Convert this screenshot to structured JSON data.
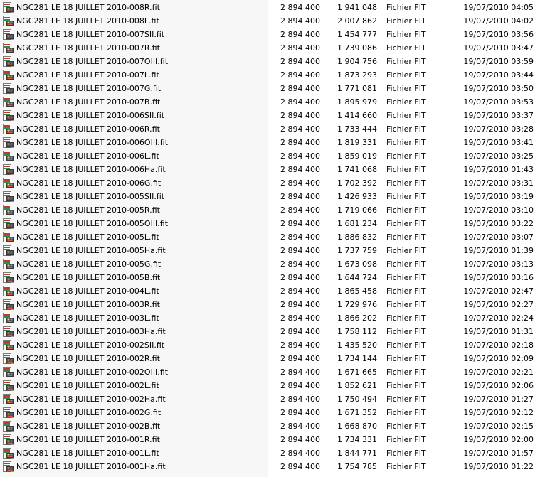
{
  "files": [
    {
      "name": "NGC281 LE 18 JUILLET 2010-008R.fit",
      "size": "2 894 400",
      "packed": "1 941 048",
      "type": "Fichier FIT",
      "date": "19/07/2010 04:05"
    },
    {
      "name": "NGC281 LE 18 JUILLET 2010-008L.fit",
      "size": "2 894 400",
      "packed": "2 007 862",
      "type": "Fichier FIT",
      "date": "19/07/2010 04:02"
    },
    {
      "name": "NGC281 LE 18 JUILLET 2010-007SII.fit",
      "size": "2 894 400",
      "packed": "1 454 777",
      "type": "Fichier FIT",
      "date": "19/07/2010 03:56"
    },
    {
      "name": "NGC281 LE 18 JUILLET 2010-007R.fit",
      "size": "2 894 400",
      "packed": "1 739 086",
      "type": "Fichier FIT",
      "date": "19/07/2010 03:47"
    },
    {
      "name": "NGC281 LE 18 JUILLET 2010-007OIII.fit",
      "size": "2 894 400",
      "packed": "1 904 756",
      "type": "Fichier FIT",
      "date": "19/07/2010 03:59"
    },
    {
      "name": "NGC281 LE 18 JUILLET 2010-007L.fit",
      "size": "2 894 400",
      "packed": "1 873 293",
      "type": "Fichier FIT",
      "date": "19/07/2010 03:44"
    },
    {
      "name": "NGC281 LE 18 JUILLET 2010-007G.fit",
      "size": "2 894 400",
      "packed": "1 771 081",
      "type": "Fichier FIT",
      "date": "19/07/2010 03:50"
    },
    {
      "name": "NGC281 LE 18 JUILLET 2010-007B.fit",
      "size": "2 894 400",
      "packed": "1 895 979",
      "type": "Fichier FIT",
      "date": "19/07/2010 03:53"
    },
    {
      "name": "NGC281 LE 18 JUILLET 2010-006SII.fit",
      "size": "2 894 400",
      "packed": "1 414 660",
      "type": "Fichier FIT",
      "date": "19/07/2010 03:37"
    },
    {
      "name": "NGC281 LE 18 JUILLET 2010-006R.fit",
      "size": "2 894 400",
      "packed": "1 733 444",
      "type": "Fichier FIT",
      "date": "19/07/2010 03:28"
    },
    {
      "name": "NGC281 LE 18 JUILLET 2010-006OIII.fit",
      "size": "2 894 400",
      "packed": "1 819 331",
      "type": "Fichier FIT",
      "date": "19/07/2010 03:41"
    },
    {
      "name": "NGC281 LE 18 JUILLET 2010-006L.fit",
      "size": "2 894 400",
      "packed": "1 859 019",
      "type": "Fichier FIT",
      "date": "19/07/2010 03:25"
    },
    {
      "name": "NGC281 LE 18 JUILLET 2010-006Ha.fit",
      "size": "2 894 400",
      "packed": "1 741 068",
      "type": "Fichier FIT",
      "date": "19/07/2010 01:43"
    },
    {
      "name": "NGC281 LE 18 JUILLET 2010-006G.fit",
      "size": "2 894 400",
      "packed": "1 702 392",
      "type": "Fichier FIT",
      "date": "19/07/2010 03:31"
    },
    {
      "name": "NGC281 LE 18 JUILLET 2010-005SII.fit",
      "size": "2 894 400",
      "packed": "1 426 933",
      "type": "Fichier FIT",
      "date": "19/07/2010 03:19"
    },
    {
      "name": "NGC281 LE 18 JUILLET 2010-005R.fit",
      "size": "2 894 400",
      "packed": "1 719 066",
      "type": "Fichier FIT",
      "date": "19/07/2010 03:10"
    },
    {
      "name": "NGC281 LE 18 JUILLET 2010-005OIII.fit",
      "size": "2 894 400",
      "packed": "1 681 234",
      "type": "Fichier FIT",
      "date": "19/07/2010 03:22"
    },
    {
      "name": "NGC281 LE 18 JUILLET 2010-005L.fit",
      "size": "2 894 400",
      "packed": "1 886 832",
      "type": "Fichier FIT",
      "date": "19/07/2010 03:07"
    },
    {
      "name": "NGC281 LE 18 JUILLET 2010-005Ha.fit",
      "size": "2 894 400",
      "packed": "1 737 759",
      "type": "Fichier FIT",
      "date": "19/07/2010 01:39"
    },
    {
      "name": "NGC281 LE 18 JUILLET 2010-005G.fit",
      "size": "2 894 400",
      "packed": "1 673 098",
      "type": "Fichier FIT",
      "date": "19/07/2010 03:13"
    },
    {
      "name": "NGC281 LE 18 JUILLET 2010-005B.fit",
      "size": "2 894 400",
      "packed": "1 644 724",
      "type": "Fichier FIT",
      "date": "19/07/2010 03:16"
    },
    {
      "name": "NGC281 LE 18 JUILLET 2010-004L.fit",
      "size": "2 894 400",
      "packed": "1 865 458",
      "type": "Fichier FIT",
      "date": "19/07/2010 02:47"
    },
    {
      "name": "NGC281 LE 18 JUILLET 2010-003R.fit",
      "size": "2 894 400",
      "packed": "1 729 976",
      "type": "Fichier FIT",
      "date": "19/07/2010 02:27"
    },
    {
      "name": "NGC281 LE 18 JUILLET 2010-003L.fit",
      "size": "2 894 400",
      "packed": "1 866 202",
      "type": "Fichier FIT",
      "date": "19/07/2010 02:24"
    },
    {
      "name": "NGC281 LE 18 JUILLET 2010-003Ha.fit",
      "size": "2 894 400",
      "packed": "1 758 112",
      "type": "Fichier FIT",
      "date": "19/07/2010 01:31"
    },
    {
      "name": "NGC281 LE 18 JUILLET 2010-002SII.fit",
      "size": "2 894 400",
      "packed": "1 435 520",
      "type": "Fichier FIT",
      "date": "19/07/2010 02:18"
    },
    {
      "name": "NGC281 LE 18 JUILLET 2010-002R.fit",
      "size": "2 894 400",
      "packed": "1 734 144",
      "type": "Fichier FIT",
      "date": "19/07/2010 02:09"
    },
    {
      "name": "NGC281 LE 18 JUILLET 2010-002OIII.fit",
      "size": "2 894 400",
      "packed": "1 671 665",
      "type": "Fichier FIT",
      "date": "19/07/2010 02:21"
    },
    {
      "name": "NGC281 LE 18 JUILLET 2010-002L.fit",
      "size": "2 894 400",
      "packed": "1 852 621",
      "type": "Fichier FIT",
      "date": "19/07/2010 02:06"
    },
    {
      "name": "NGC281 LE 18 JUILLET 2010-002Ha.fit",
      "size": "2 894 400",
      "packed": "1 750 494",
      "type": "Fichier FIT",
      "date": "19/07/2010 01:27"
    },
    {
      "name": "NGC281 LE 18 JUILLET 2010-002G.fit",
      "size": "2 894 400",
      "packed": "1 671 352",
      "type": "Fichier FIT",
      "date": "19/07/2010 02:12"
    },
    {
      "name": "NGC281 LE 18 JUILLET 2010-002B.fit",
      "size": "2 894 400",
      "packed": "1 668 870",
      "type": "Fichier FIT",
      "date": "19/07/2010 02:15"
    },
    {
      "name": "NGC281 LE 18 JUILLET 2010-001R.fit",
      "size": "2 894 400",
      "packed": "1 734 331",
      "type": "Fichier FIT",
      "date": "19/07/2010 02:00"
    },
    {
      "name": "NGC281 LE 18 JUILLET 2010-001L.fit",
      "size": "2 894 400",
      "packed": "1 844 771",
      "type": "Fichier FIT",
      "date": "19/07/2010 01:57"
    },
    {
      "name": "NGC281 LE 18 JUILLET 2010-001Ha.fit",
      "size": "2 894 400",
      "packed": "1 754 785",
      "type": "Fichier FIT",
      "date": "19/07/2010 01:22"
    }
  ],
  "icon": "fit-file-icon"
}
